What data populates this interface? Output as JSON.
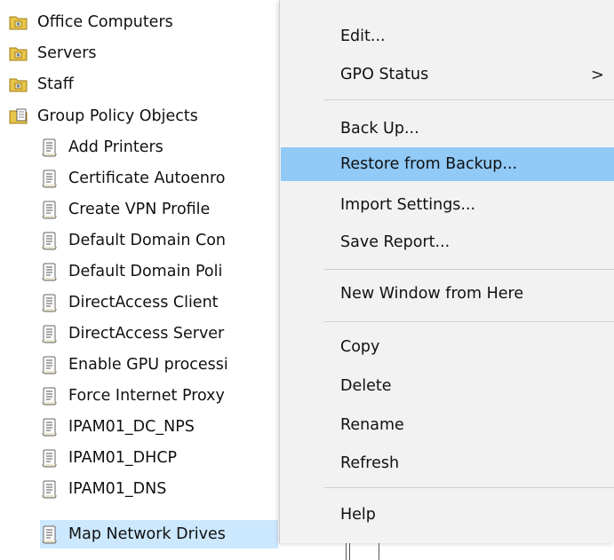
{
  "tree": {
    "items": [
      {
        "label": "Office Computers",
        "icon": "ou-folder-icon"
      },
      {
        "label": "Servers",
        "icon": "ou-folder-icon"
      },
      {
        "label": "Staff",
        "icon": "ou-folder-icon"
      },
      {
        "label": "Group Policy Objects",
        "icon": "gpo-container-icon"
      },
      {
        "label": "Add Printers",
        "icon": "gpo-scroll-icon"
      },
      {
        "label": "Certificate Autoenro",
        "icon": "gpo-scroll-icon"
      },
      {
        "label": "Create VPN Profile",
        "icon": "gpo-scroll-icon"
      },
      {
        "label": "Default Domain Con",
        "icon": "gpo-scroll-icon"
      },
      {
        "label": "Default Domain Poli",
        "icon": "gpo-scroll-icon"
      },
      {
        "label": "DirectAccess Client",
        "icon": "gpo-scroll-icon"
      },
      {
        "label": "DirectAccess Server",
        "icon": "gpo-scroll-icon"
      },
      {
        "label": "Enable GPU processi",
        "icon": "gpo-scroll-icon"
      },
      {
        "label": "Force Internet Proxy",
        "icon": "gpo-scroll-icon"
      },
      {
        "label": "IPAM01_DC_NPS",
        "icon": "gpo-scroll-icon"
      },
      {
        "label": "IPAM01_DHCP",
        "icon": "gpo-scroll-icon"
      },
      {
        "label": "IPAM01_DNS",
        "icon": "gpo-scroll-icon"
      },
      {
        "label": "Map Network Drives",
        "icon": "gpo-scroll-icon"
      }
    ],
    "selected_label": "Map Network Drives"
  },
  "context_menu": {
    "items": [
      {
        "label": "Edit..."
      },
      {
        "label": "GPO Status",
        "submenu_arrow": ">"
      },
      {
        "label": "Back Up..."
      },
      {
        "label": "Restore from Backup..."
      },
      {
        "label": "Import Settings..."
      },
      {
        "label": "Save Report..."
      },
      {
        "label": "New Window from Here"
      },
      {
        "label": "Copy"
      },
      {
        "label": "Delete"
      },
      {
        "label": "Rename"
      },
      {
        "label": "Refresh"
      },
      {
        "label": "Help"
      }
    ],
    "highlighted_label": "Restore from Backup..."
  },
  "colors": {
    "menu_background": "#f2f2f2",
    "menu_highlight": "#91c9f7",
    "tree_selection": "#cce8ff",
    "folder_yellow": "#e8c44a"
  }
}
